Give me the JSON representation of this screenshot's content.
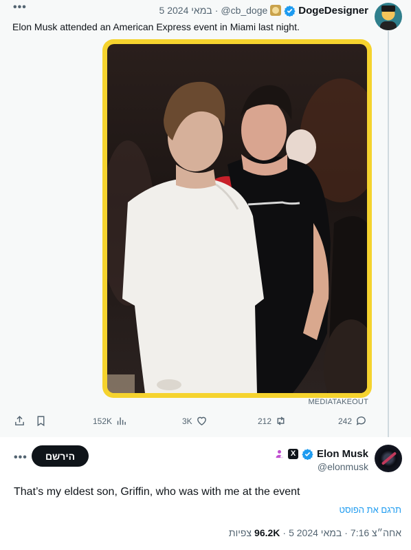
{
  "parent_tweet": {
    "more_label": "•••",
    "author_name": "DogeDesigner",
    "handle": "@cb_doge",
    "separator": "·",
    "date": "5 במאי 2024",
    "text": "Elon Musk attended an American Express event in Miami last night.",
    "image_credit": "MEDIATAKEOUT",
    "actions": {
      "reply_count": "242",
      "repost_count": "212",
      "like_count": "3K",
      "views_count": "152K"
    }
  },
  "main_tweet": {
    "more_label": "•••",
    "subscribe_label": "הירשם",
    "author_name": "Elon Musk",
    "x_badge": "X",
    "handle": "@elonmusk",
    "text": "That’s my eldest son, Griffin, who was with me at the event",
    "translate_label": "תרגם את הפוסט",
    "time": "7:16 אחה״צ",
    "separator": "·",
    "date": "5 במאי 2024",
    "views_count": "96.2K",
    "views_label": "צפיות"
  },
  "colors": {
    "accent": "#1d9bf0",
    "verified": "#1d9bf0",
    "muted": "#536471",
    "image_border": "#f5d32e",
    "parent_bg": "#f7f9f9"
  },
  "icons": [
    "more-icon",
    "verified-badge-icon",
    "share-icon",
    "bookmark-icon",
    "views-icon",
    "like-icon",
    "repost-icon",
    "reply-icon",
    "x-badge-icon",
    "affiliate-icon"
  ]
}
